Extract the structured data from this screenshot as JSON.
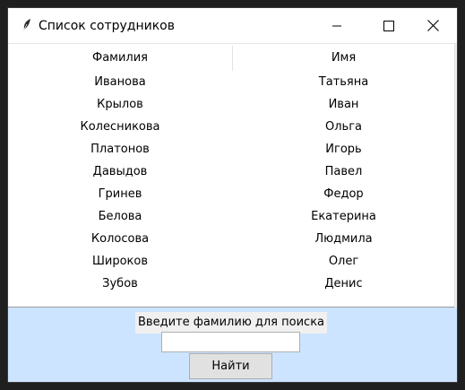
{
  "window": {
    "title": "Список сотрудников",
    "controls": {
      "minimize_icon": "minimize-icon",
      "maximize_icon": "maximize-icon",
      "close_icon": "close-icon"
    }
  },
  "table": {
    "columns": [
      "Фамилия",
      "Имя"
    ],
    "rows": [
      [
        "Иванова",
        "Татьяна"
      ],
      [
        "Крылов",
        "Иван"
      ],
      [
        "Колесникова",
        "Ольга"
      ],
      [
        "Платонов",
        "Игорь"
      ],
      [
        "Давыдов",
        "Павел"
      ],
      [
        "Гринев",
        "Федор"
      ],
      [
        "Белова",
        "Екатерина"
      ],
      [
        "Колосова",
        "Людмила"
      ],
      [
        "Широков",
        "Олег"
      ],
      [
        "Зубов",
        "Денис"
      ]
    ]
  },
  "search": {
    "prompt": "Введите фамилию для поиска",
    "value": "",
    "button_label": "Найти"
  },
  "colors": {
    "bottom_panel": "#cce4ff",
    "button_face": "#e1e1e1"
  }
}
